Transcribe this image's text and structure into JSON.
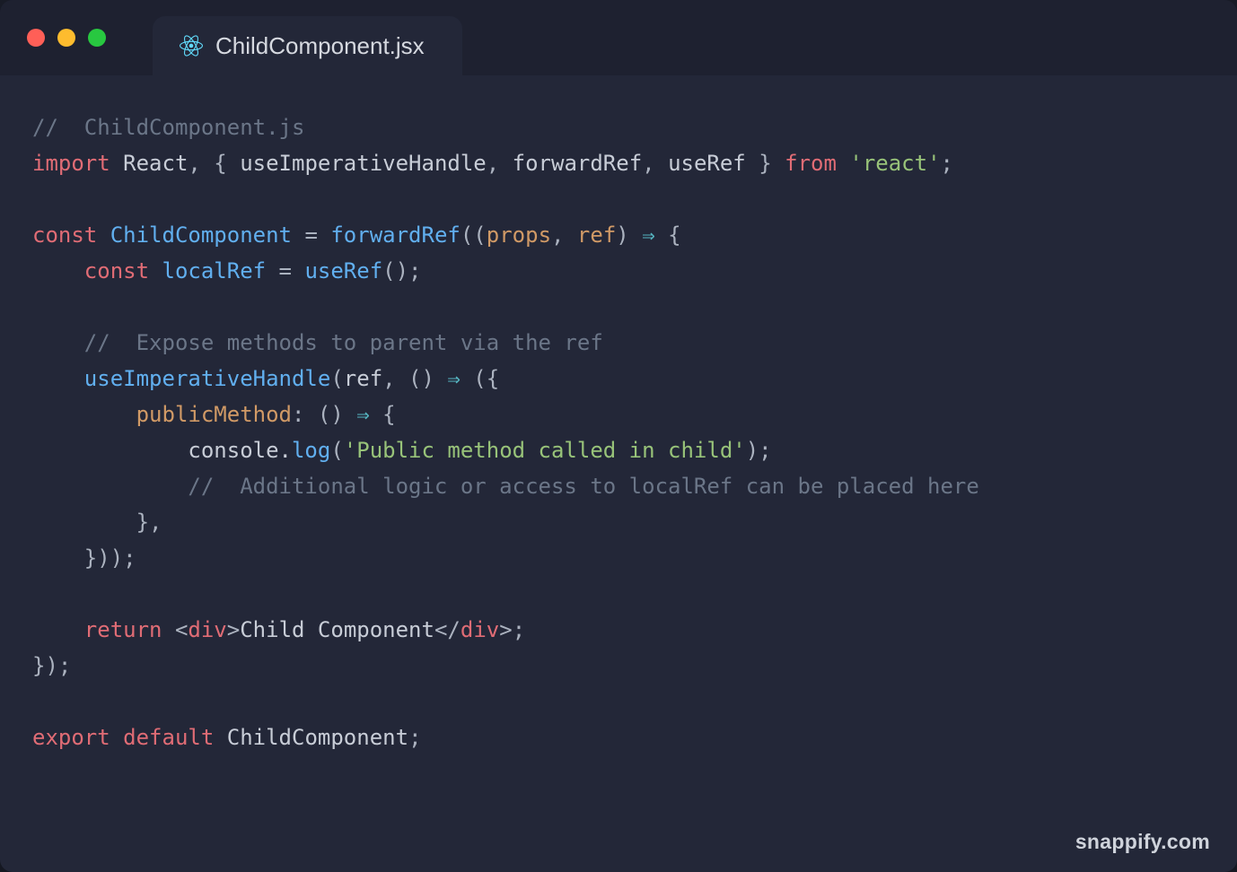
{
  "tab": {
    "title": "ChildComponent.jsx",
    "icon": "react-icon"
  },
  "watermark": "snappify.com",
  "code": {
    "lines": [
      [
        {
          "c": "tok-comment",
          "t": "//  ChildComponent.js"
        }
      ],
      [
        {
          "c": "tok-keyword",
          "t": "import"
        },
        {
          "c": "tok-plain",
          "t": " React"
        },
        {
          "c": "tok-punct",
          "t": ", { "
        },
        {
          "c": "tok-plain",
          "t": "useImperativeHandle"
        },
        {
          "c": "tok-punct",
          "t": ", "
        },
        {
          "c": "tok-plain",
          "t": "forwardRef"
        },
        {
          "c": "tok-punct",
          "t": ", "
        },
        {
          "c": "tok-plain",
          "t": "useRef"
        },
        {
          "c": "tok-punct",
          "t": " } "
        },
        {
          "c": "tok-keyword",
          "t": "from"
        },
        {
          "c": "tok-plain",
          "t": " "
        },
        {
          "c": "tok-string",
          "t": "'react'"
        },
        {
          "c": "tok-punct",
          "t": ";"
        }
      ],
      [],
      [
        {
          "c": "tok-keyword",
          "t": "const"
        },
        {
          "c": "tok-plain",
          "t": " "
        },
        {
          "c": "tok-identifier",
          "t": "ChildComponent"
        },
        {
          "c": "tok-plain",
          "t": " "
        },
        {
          "c": "tok-operator",
          "t": "="
        },
        {
          "c": "tok-plain",
          "t": " "
        },
        {
          "c": "tok-func",
          "t": "forwardRef"
        },
        {
          "c": "tok-punct",
          "t": "(("
        },
        {
          "c": "tok-param",
          "t": "props"
        },
        {
          "c": "tok-punct",
          "t": ", "
        },
        {
          "c": "tok-param",
          "t": "ref"
        },
        {
          "c": "tok-punct",
          "t": ") "
        },
        {
          "c": "tok-arrow",
          "t": "⇒"
        },
        {
          "c": "tok-punct",
          "t": " {"
        }
      ],
      [
        {
          "c": "tok-plain",
          "t": "    "
        },
        {
          "c": "tok-keyword",
          "t": "const"
        },
        {
          "c": "tok-plain",
          "t": " "
        },
        {
          "c": "tok-identifier",
          "t": "localRef"
        },
        {
          "c": "tok-plain",
          "t": " "
        },
        {
          "c": "tok-operator",
          "t": "="
        },
        {
          "c": "tok-plain",
          "t": " "
        },
        {
          "c": "tok-func",
          "t": "useRef"
        },
        {
          "c": "tok-punct",
          "t": "();"
        }
      ],
      [],
      [
        {
          "c": "tok-plain",
          "t": "    "
        },
        {
          "c": "tok-comment",
          "t": "//  Expose methods to parent via the ref"
        }
      ],
      [
        {
          "c": "tok-plain",
          "t": "    "
        },
        {
          "c": "tok-func",
          "t": "useImperativeHandle"
        },
        {
          "c": "tok-punct",
          "t": "("
        },
        {
          "c": "tok-plain",
          "t": "ref"
        },
        {
          "c": "tok-punct",
          "t": ", () "
        },
        {
          "c": "tok-arrow",
          "t": "⇒"
        },
        {
          "c": "tok-punct",
          "t": " ({"
        }
      ],
      [
        {
          "c": "tok-plain",
          "t": "        "
        },
        {
          "c": "tok-prop",
          "t": "publicMethod"
        },
        {
          "c": "tok-punct",
          "t": ": () "
        },
        {
          "c": "tok-arrow",
          "t": "⇒"
        },
        {
          "c": "tok-punct",
          "t": " {"
        }
      ],
      [
        {
          "c": "tok-plain",
          "t": "            console."
        },
        {
          "c": "tok-func",
          "t": "log"
        },
        {
          "c": "tok-punct",
          "t": "("
        },
        {
          "c": "tok-string",
          "t": "'Public method called in child'"
        },
        {
          "c": "tok-punct",
          "t": ");"
        }
      ],
      [
        {
          "c": "tok-plain",
          "t": "            "
        },
        {
          "c": "tok-comment",
          "t": "//  Additional logic or access to localRef can be placed here"
        }
      ],
      [
        {
          "c": "tok-plain",
          "t": "        "
        },
        {
          "c": "tok-punct",
          "t": "},"
        }
      ],
      [
        {
          "c": "tok-plain",
          "t": "    "
        },
        {
          "c": "tok-punct",
          "t": "}));"
        }
      ],
      [],
      [
        {
          "c": "tok-plain",
          "t": "    "
        },
        {
          "c": "tok-keyword",
          "t": "return"
        },
        {
          "c": "tok-plain",
          "t": " "
        },
        {
          "c": "tok-tagpunct",
          "t": "<"
        },
        {
          "c": "tok-tag",
          "t": "div"
        },
        {
          "c": "tok-tagpunct",
          "t": ">"
        },
        {
          "c": "tok-jsxtext",
          "t": "Child Component"
        },
        {
          "c": "tok-tagpunct",
          "t": "</"
        },
        {
          "c": "tok-tag",
          "t": "div"
        },
        {
          "c": "tok-tagpunct",
          "t": ">"
        },
        {
          "c": "tok-punct",
          "t": ";"
        }
      ],
      [
        {
          "c": "tok-punct",
          "t": "});"
        }
      ],
      [],
      [
        {
          "c": "tok-keyword",
          "t": "export"
        },
        {
          "c": "tok-plain",
          "t": " "
        },
        {
          "c": "tok-keyword",
          "t": "default"
        },
        {
          "c": "tok-plain",
          "t": " ChildComponent"
        },
        {
          "c": "tok-punct",
          "t": ";"
        }
      ]
    ]
  }
}
